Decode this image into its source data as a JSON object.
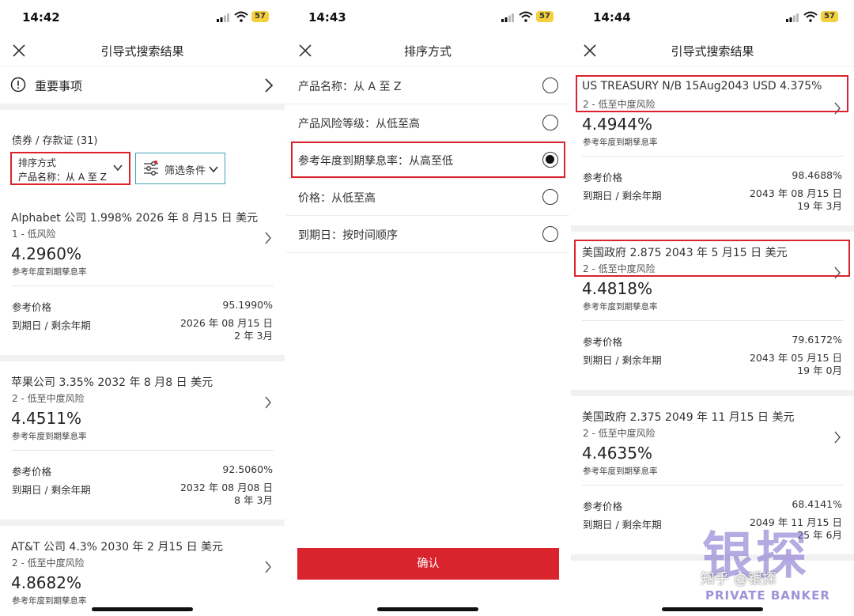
{
  "status": {
    "s1": {
      "time": "14:42",
      "battery": "57"
    },
    "s2": {
      "time": "14:43",
      "battery": "57"
    },
    "s3": {
      "time": "14:44",
      "battery": "57"
    }
  },
  "screen1": {
    "title": "引导式搜索结果",
    "notice": "重要事项",
    "category": "债券 / 存款证 (31)",
    "sort_label": "排序方式",
    "sort_value": "产品名称：从 A 至 Z",
    "filter_label": "筛选条件",
    "items": [
      {
        "name": "Alphabet 公司 1.998% 2026 年 8 月15 日 美元",
        "risk": "1 - 低风险",
        "yield": "4.2960%",
        "yield_label": "参考年度到期孳息率",
        "price_label": "参考价格",
        "price": "95.1990%",
        "maturity_label": "到期日 / 剩余年期",
        "maturity_date": "2026 年 08 月15 日",
        "remaining": "2 年 3月"
      },
      {
        "name": "苹果公司 3.35% 2032 年 8 月8 日 美元",
        "risk": "2 - 低至中度风险",
        "yield": "4.4511%",
        "yield_label": "参考年度到期孳息率",
        "price_label": "参考价格",
        "price": "92.5060%",
        "maturity_label": "到期日 / 剩余年期",
        "maturity_date": "2032 年 08 月08 日",
        "remaining": "8 年 3月"
      },
      {
        "name": "AT&T 公司 4.3% 2030 年 2 月15 日 美元",
        "risk": "2 - 低至中度风险",
        "yield": "4.8682%",
        "yield_label": "参考年度到期孳息率"
      }
    ]
  },
  "screen2": {
    "title": "排序方式",
    "options": [
      {
        "label": "产品名称：从 A 至 Z",
        "selected": false
      },
      {
        "label": "产品风险等级：从低至高",
        "selected": false
      },
      {
        "label": "参考年度到期孳息率：从高至低",
        "selected": true
      },
      {
        "label": "价格：从低至高",
        "selected": false
      },
      {
        "label": "到期日：按时间顺序",
        "selected": false
      }
    ],
    "confirm": "确认"
  },
  "screen3": {
    "title": "引导式搜索结果",
    "items": [
      {
        "name": "US TREASURY N/B 15Aug2043 USD 4.375%",
        "risk": "2 - 低至中度风险",
        "yield": "4.4944%",
        "yield_label": "参考年度到期孳息率",
        "price_label": "参考价格",
        "price": "98.4688%",
        "maturity_label": "到期日 / 剩余年期",
        "maturity_date": "2043 年 08 月15 日",
        "remaining": "19 年 3月"
      },
      {
        "name": "美国政府 2.875 2043 年 5 月15 日 美元",
        "risk": "2 - 低至中度风险",
        "yield": "4.4818%",
        "yield_label": "参考年度到期孳息率",
        "price_label": "参考价格",
        "price": "79.6172%",
        "maturity_label": "到期日 / 剩余年期",
        "maturity_date": "2043 年 05 月15 日",
        "remaining": "19 年 0月"
      },
      {
        "name": "美国政府 2.375 2049 年 11 月15 日 美元",
        "risk": "2 - 低至中度风险",
        "yield": "4.4635%",
        "yield_label": "参考年度到期孳息率",
        "price_label": "参考价格",
        "price": "68.4141%",
        "maturity_label": "到期日 / 剩余年期",
        "maturity_date": "2049 年 11 月15 日",
        "remaining": "25 年 6月"
      }
    ]
  },
  "watermark": {
    "big": "银探",
    "zh": "知乎 @银探",
    "en": "PRIVATE BANKER"
  },
  "colors": {
    "accent_red": "#d9232d",
    "filter_border": "#41a6b5",
    "battery": "#f4d03f"
  }
}
